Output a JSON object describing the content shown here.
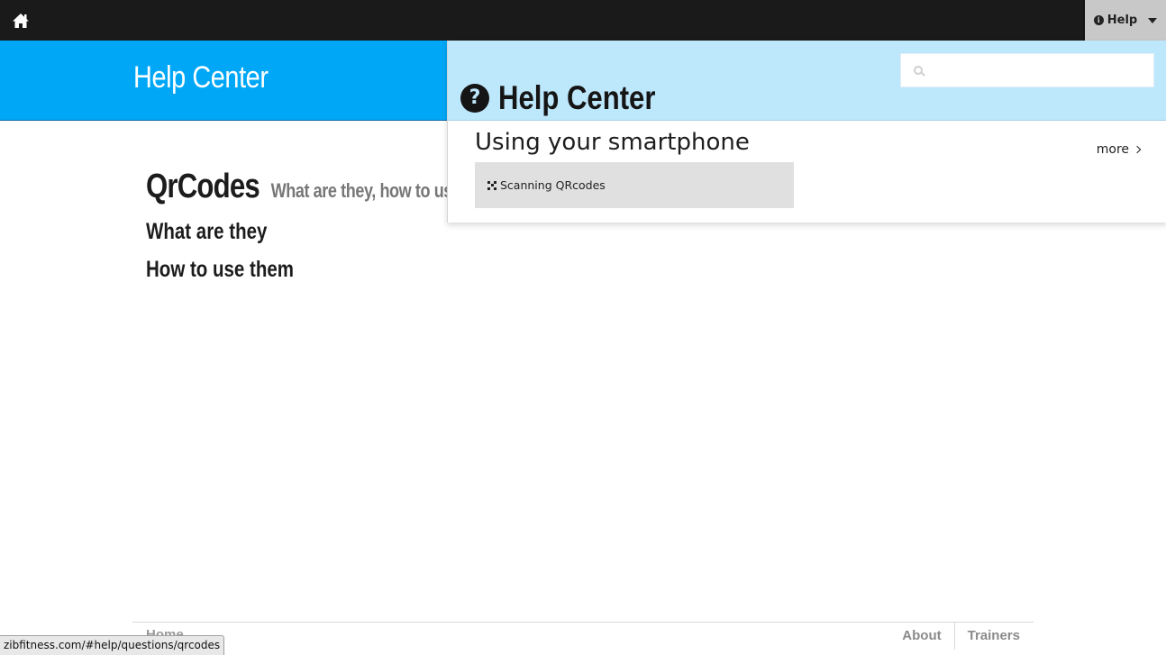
{
  "topbar": {
    "home_icon": "home-icon",
    "help_label": "Help",
    "help_icon": "info-icon"
  },
  "banner": {
    "title": "Help Center"
  },
  "main": {
    "title": "QrCodes",
    "subtitle": "What are they, how to use them",
    "sections": [
      "What are they",
      "How to use them"
    ]
  },
  "overlay": {
    "search": {
      "placeholder": "",
      "value": ""
    },
    "title": "Help Center",
    "title_icon": "question-circle-icon",
    "section_title": "Using your smartphone",
    "more_label": "more",
    "items": [
      {
        "icon": "qrcode-icon",
        "label": "Scanning QRcodes"
      }
    ]
  },
  "footer": {
    "home_label": "Home",
    "links": [
      "About",
      "Trainers"
    ]
  },
  "status_bar": {
    "url": "zibfitness.com/#help/questions/qrcodes"
  },
  "colors": {
    "topbar": "#1a1a1a",
    "banner": "#00a7f7",
    "overlay_head": "#bde7fb",
    "item_bg": "#e0e0e0"
  }
}
